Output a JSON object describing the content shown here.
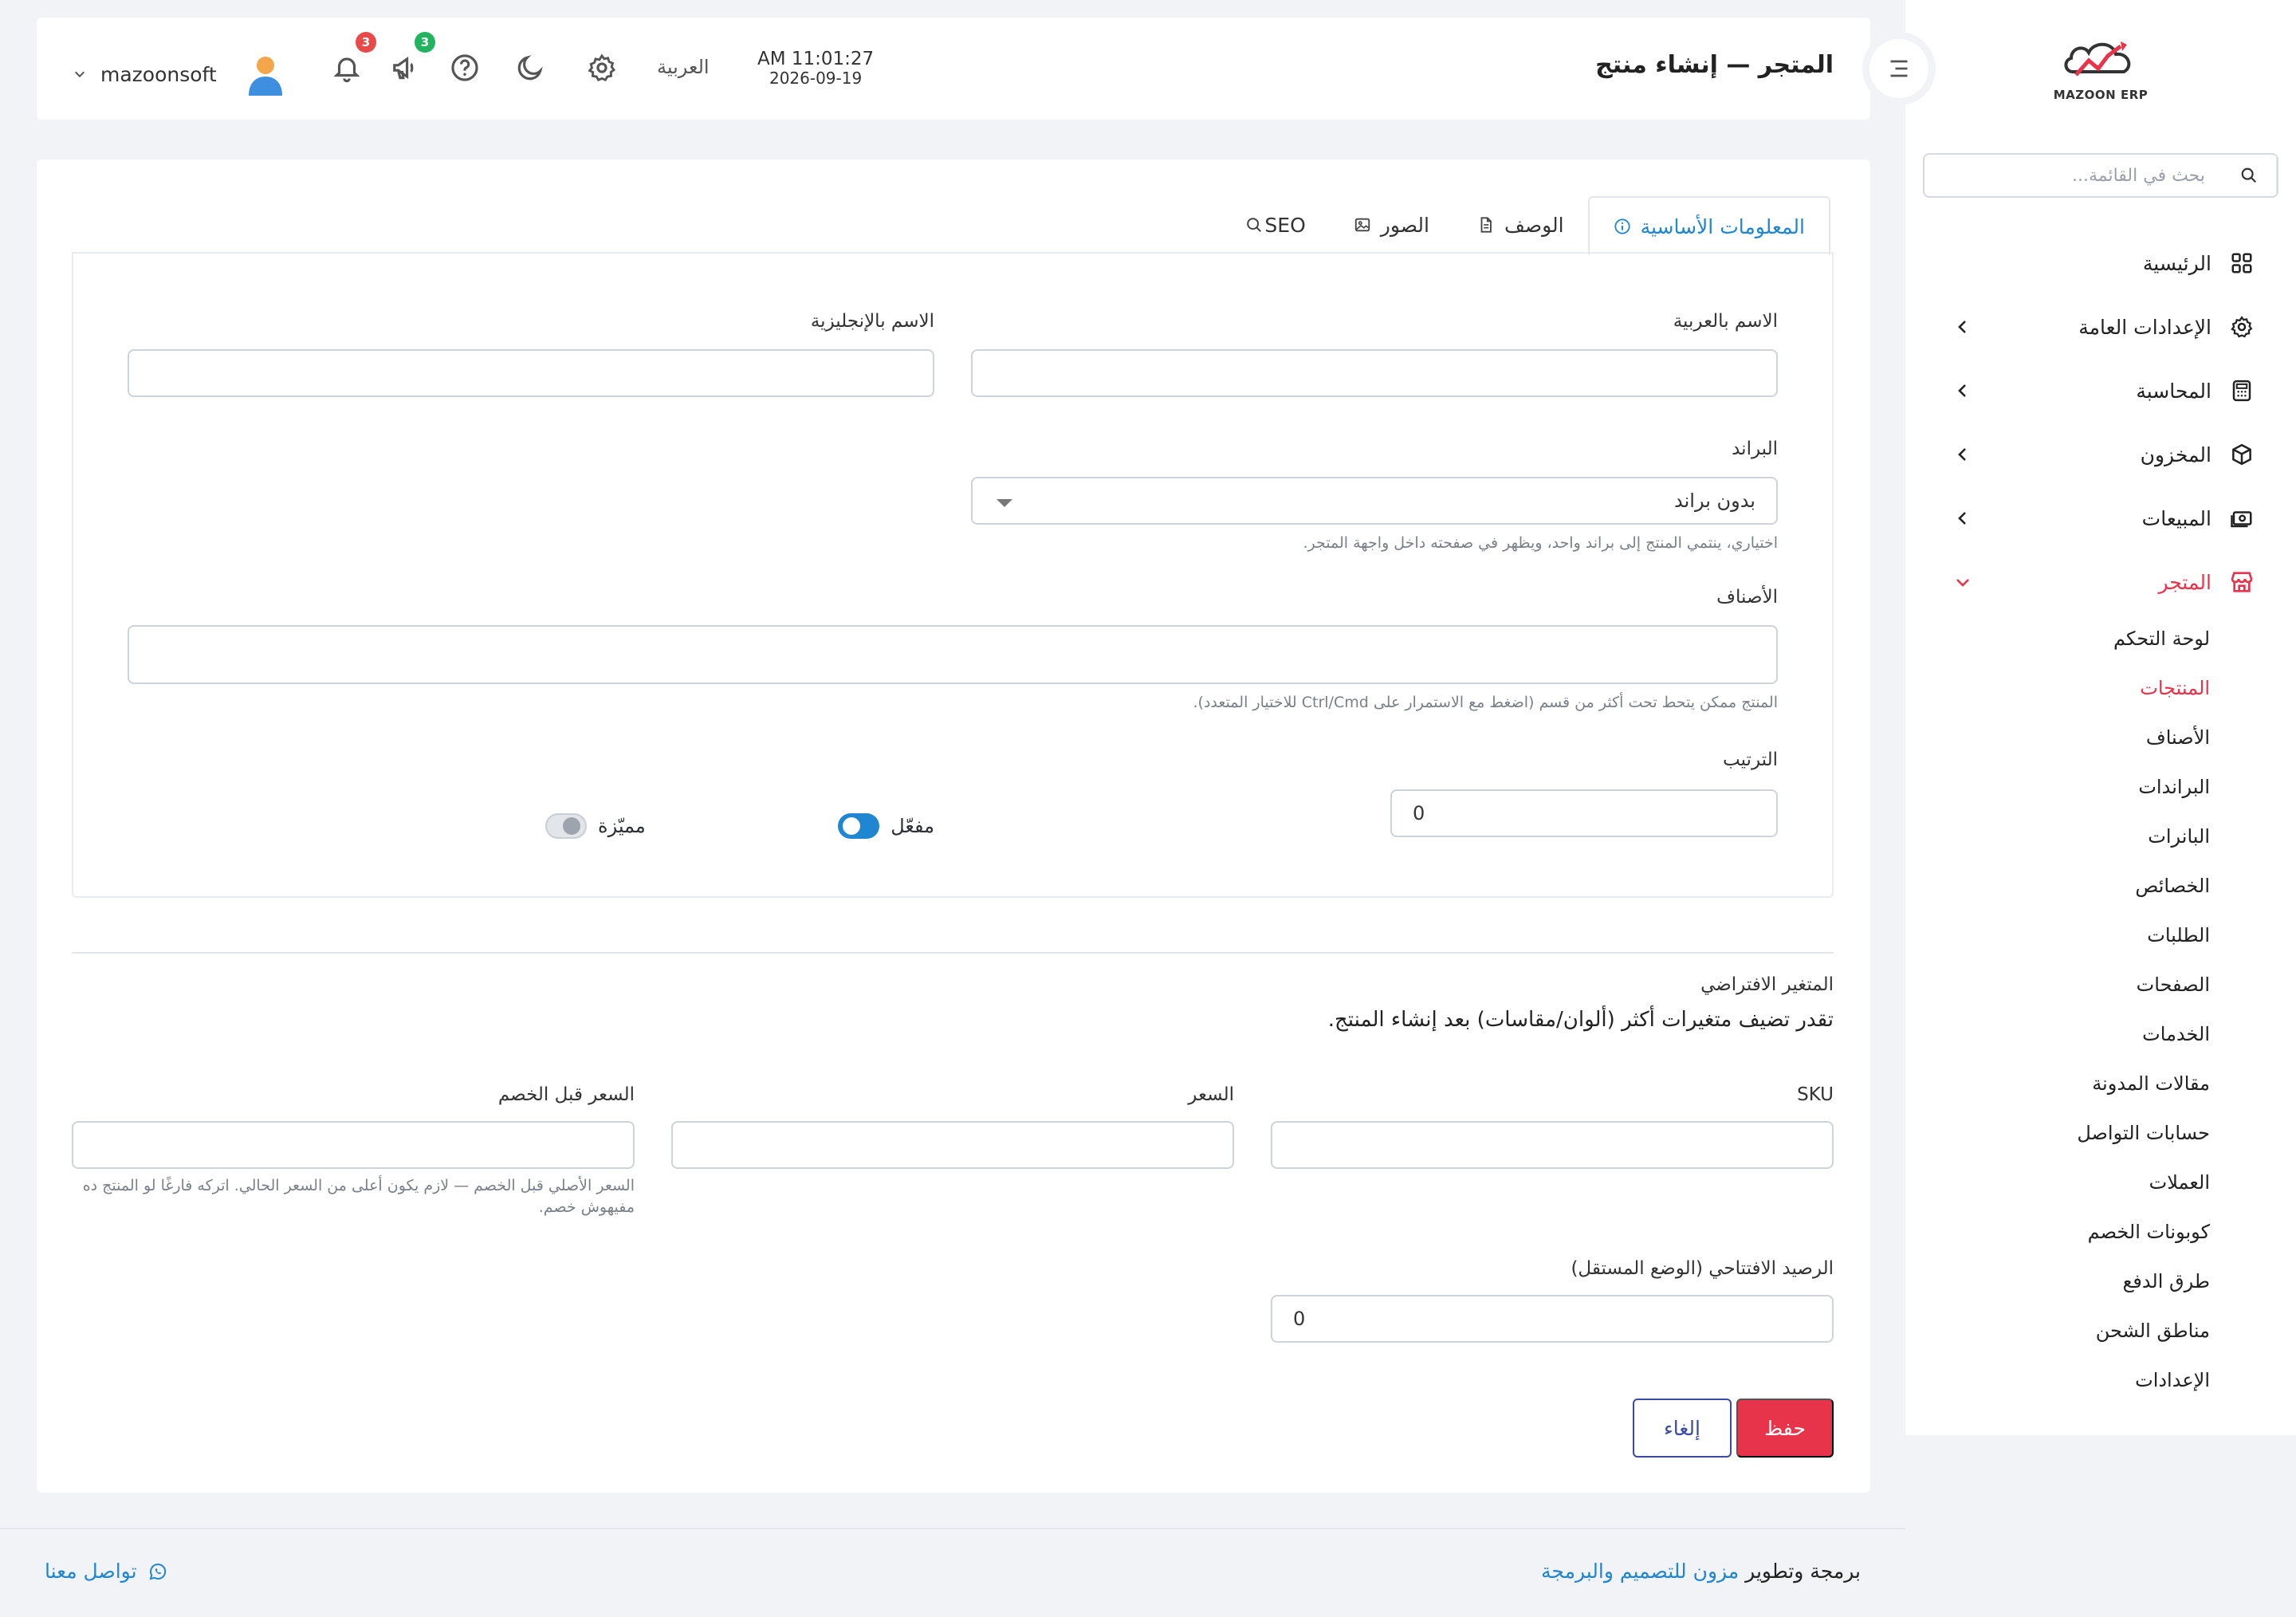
{
  "brand": {
    "logo_text": "MAZOON ERP"
  },
  "sidebar": {
    "search_placeholder": "بحث في القائمة...",
    "items": [
      {
        "label": "الرئيسية",
        "icon": "grid-icon"
      },
      {
        "label": "الإعدادات العامة",
        "icon": "gear-icon"
      },
      {
        "label": "المحاسبة",
        "icon": "calculator-icon"
      },
      {
        "label": "المخزون",
        "icon": "box-icon"
      },
      {
        "label": "المبيعات",
        "icon": "cash-icon"
      },
      {
        "label": "المتجر",
        "icon": "store-icon"
      }
    ],
    "store_sub": [
      "لوحة التحكم",
      "المنتجات",
      "الأصناف",
      "البراندات",
      "البانرات",
      "الخصائص",
      "الطلبات",
      "الصفحات",
      "الخدمات",
      "مقالات المدونة",
      "حسابات التواصل",
      "العملات",
      "كوبونات الخصم",
      "طرق الدفع",
      "مناطق الشحن",
      "الإعدادات"
    ]
  },
  "header": {
    "title": "المتجر — إنشاء منتج",
    "time": "AM 11:01:27",
    "date": "2026-09-19",
    "language": "العربية",
    "notifications_count": "3",
    "announcements_count": "3",
    "username": "mazoonsoft"
  },
  "tabs": [
    {
      "label": "المعلومات الأساسية",
      "icon": "info-icon"
    },
    {
      "label": "الوصف",
      "icon": "document-icon"
    },
    {
      "label": "الصور",
      "icon": "image-icon"
    },
    {
      "label": "SEO",
      "icon": "search-icon"
    }
  ],
  "form": {
    "name_ar_label": "الاسم بالعربية",
    "name_en_label": "الاسم بالإنجليزية",
    "brand_label": "البراند",
    "brand_value": "بدون براند",
    "brand_hint": "اختياري، ينتمي المنتج إلى براند واحد، ويظهر في صفحته داخل واجهة المتجر.",
    "categories_label": "الأصناف",
    "categories_hint": "المنتج ممكن يتحط تحت أكثر من قسم (اضغط مع الاستمرار على Ctrl/Cmd للاختيار المتعدد).",
    "order_label": "الترتيب",
    "order_value": "0",
    "featured_label": "مميّزة",
    "enabled_label": "مفعّل"
  },
  "variant": {
    "title": "المتغير الافتراضي",
    "note": "تقدر تضيف متغيرات أكثر (ألوان/مقاسات) بعد إنشاء المنتج.",
    "sku_label": "SKU",
    "price_label": "السعر",
    "compare_price_label": "السعر قبل الخصم",
    "compare_price_hint": "السعر الأصلي قبل الخصم — لازم يكون أعلى من السعر الحالي. اتركه فارغًا لو المنتج ده مفيهوش خصم.",
    "opening_stock_label": "الرصيد الافتتاحي (الوضع المستقل)",
    "opening_stock_value": "0"
  },
  "actions": {
    "save": "حفظ",
    "cancel": "إلغاء"
  },
  "footer": {
    "credit_prefix": "برمجة وتطوير",
    "credit_link": "مزون للتصميم والبرمجة",
    "contact": "تواصل معنا"
  },
  "colors": {
    "accent": "#e8344a",
    "link": "#1f86d1",
    "toggle_on": "#1f86d1",
    "badge_red": "#e84a4a",
    "badge_green": "#22b35e"
  }
}
